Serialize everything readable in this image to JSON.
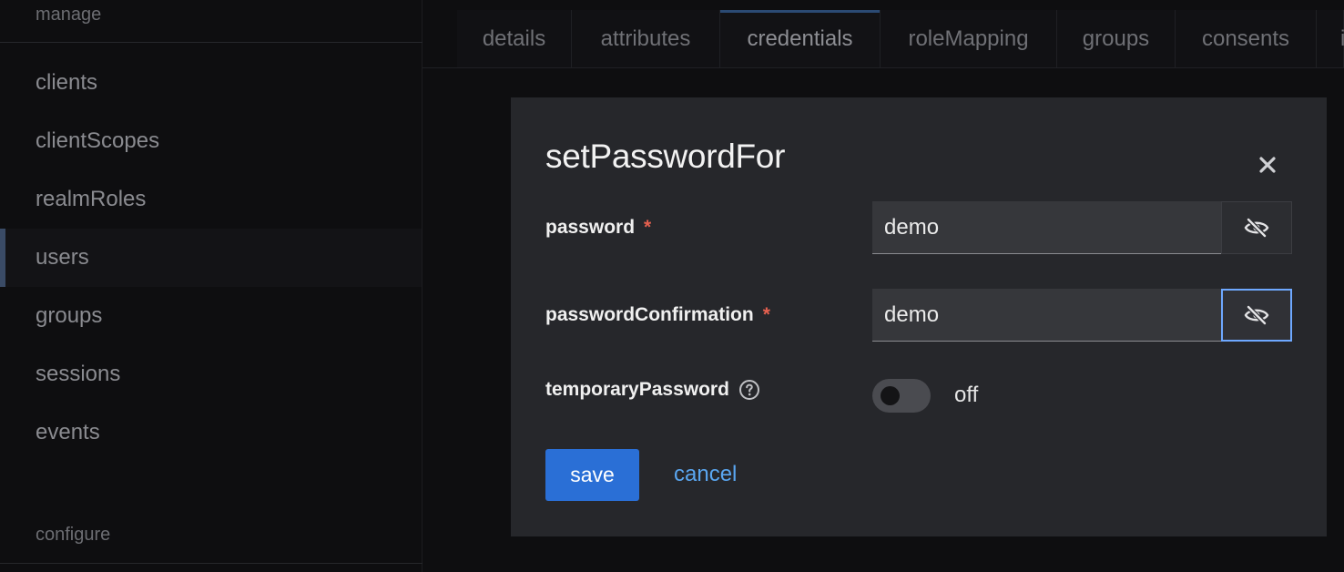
{
  "sidebar": {
    "manage_title": "manage",
    "configure_title": "configure",
    "items": [
      {
        "label": "clients"
      },
      {
        "label": "clientScopes"
      },
      {
        "label": "realmRoles"
      },
      {
        "label": "users",
        "active": true
      },
      {
        "label": "groups"
      },
      {
        "label": "sessions"
      },
      {
        "label": "events"
      }
    ]
  },
  "tabs": [
    {
      "label": "details"
    },
    {
      "label": "attributes"
    },
    {
      "label": "credentials",
      "active": true
    },
    {
      "label": "roleMapping"
    },
    {
      "label": "groups"
    },
    {
      "label": "consents"
    },
    {
      "label": "i"
    }
  ],
  "modal": {
    "title": "setPasswordFor",
    "password_label": "password",
    "password_value": "demo",
    "confirmation_label": "passwordConfirmation",
    "confirmation_value": "demo",
    "required_marker": "*",
    "temporary_label": "temporaryPassword",
    "temporary_state": "off",
    "save_label": "save",
    "cancel_label": "cancel"
  },
  "icons": {
    "close": "close-icon",
    "eye_slash": "eye-slash-icon",
    "help": "help-icon"
  },
  "colors": {
    "primary": "#2a6fd6",
    "link": "#5aa6f0",
    "required": "#e5604f",
    "focus": "#6ea8ff"
  }
}
